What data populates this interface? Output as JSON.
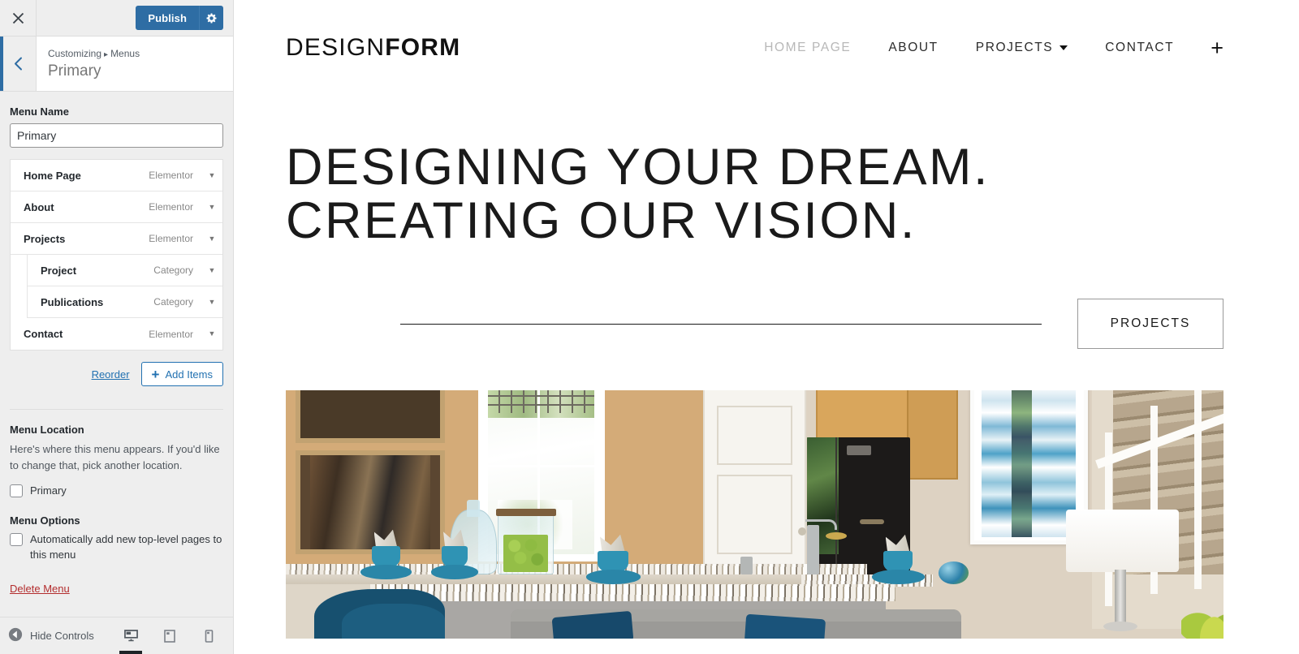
{
  "customizer": {
    "topbar": {
      "close_icon": "close-icon",
      "publish_label": "Publish",
      "settings_icon": "gear-icon"
    },
    "panel_header": {
      "back_icon": "chevron-left-icon",
      "breadcrumb_root": "Customizing",
      "breadcrumb_separator": "▸",
      "breadcrumb_section": "Menus",
      "title": "Primary"
    },
    "menu_name": {
      "label": "Menu Name",
      "value": "Primary",
      "placeholder": "Menu Name"
    },
    "menu_items": [
      {
        "title": "Home Page",
        "type": "Elementor",
        "depth": 0
      },
      {
        "title": "About",
        "type": "Elementor",
        "depth": 0
      },
      {
        "title": "Projects",
        "type": "Elementor",
        "depth": 0
      },
      {
        "title": "Project",
        "type": "Category",
        "depth": 1
      },
      {
        "title": "Publications",
        "type": "Category",
        "depth": 1
      },
      {
        "title": "Contact",
        "type": "Elementor",
        "depth": 0
      }
    ],
    "list_actions": {
      "reorder_label": "Reorder",
      "add_items_label": "Add Items",
      "add_items_icon": "plus-icon"
    },
    "menu_location": {
      "heading": "Menu Location",
      "help_text": "Here's where this menu appears. If you'd like to change that, pick another location.",
      "checkbox_label": "Primary",
      "checked": false
    },
    "menu_options": {
      "heading": "Menu Options",
      "checkbox_label": "Automatically add new top-level pages to this menu",
      "checked": false
    },
    "delete_menu_label": "Delete Menu",
    "footer": {
      "hide_controls_label": "Hide Controls",
      "hide_controls_icon": "collapse-arrow-icon",
      "devices": [
        {
          "name": "desktop",
          "icon": "desktop-icon",
          "active": true
        },
        {
          "name": "tablet",
          "icon": "tablet-icon",
          "active": false
        },
        {
          "name": "mobile",
          "icon": "mobile-icon",
          "active": false
        }
      ]
    }
  },
  "preview": {
    "logo": {
      "light_part": "DESIGN",
      "bold_part": "FORM"
    },
    "nav": [
      {
        "label": "HOME PAGE",
        "current": true,
        "has_dropdown": false
      },
      {
        "label": "ABOUT",
        "current": false,
        "has_dropdown": false
      },
      {
        "label": "PROJECTS",
        "current": false,
        "has_dropdown": true
      },
      {
        "label": "CONTACT",
        "current": false,
        "has_dropdown": false
      }
    ],
    "nav_add_icon": "plus-icon",
    "hero": {
      "line1_thin": "DESIGNING YOUR DREAM.",
      "line2_thin": "CREATING ",
      "line2_strong": "OUR VISION.",
      "cta_label": "PROJECTS"
    },
    "photo_alt": "interior-kitchen-living-room-photo"
  },
  "colors": {
    "accent_blue": "#2e6da4",
    "link_blue": "#2271b1",
    "delete_red": "#b32d2e",
    "sidebar_bg": "#eeeeee",
    "nav_current_grey": "#b8b8b8"
  }
}
